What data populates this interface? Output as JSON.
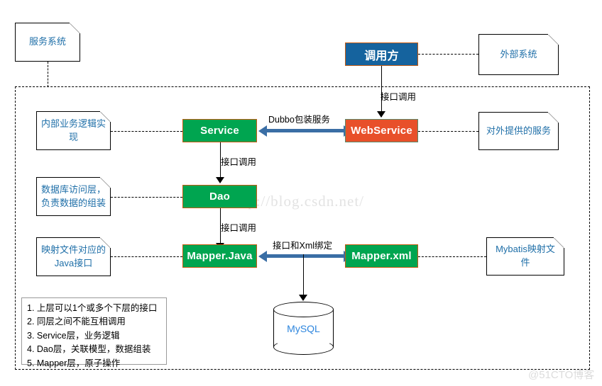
{
  "diagram": {
    "title_note": "服务系统",
    "boundary_label": "",
    "watermarks": {
      "url": "http://blog.csdn.net/",
      "site": "@51CTO博客"
    },
    "notes": {
      "service_system": "服务系统",
      "external_system": "外部系统",
      "service_desc": "内部业务逻辑实现",
      "dao_desc": "数据库访问层，负责数据的组装",
      "mapper_java_desc": "映射文件对应的Java接口",
      "webservice_desc": "对外提供的服务",
      "mapper_xml_desc": "Mybatis映射文件"
    },
    "boxes": {
      "caller": "调用方",
      "service": "Service",
      "webservice": "WebService",
      "dao": "Dao",
      "mapper_java": "Mapper.Java",
      "mapper_xml": "Mapper.xml",
      "database": "MySQL"
    },
    "edge_labels": {
      "caller_to_webservice": "接口调用",
      "service_to_webservice": "Dubbo包装服务",
      "service_to_dao": "接口调用",
      "dao_to_mapper": "接口调用",
      "mapper_binding": "接口和Xml绑定"
    },
    "legend": {
      "items": [
        "1. 上层可以1个或多个下层的接口",
        "2. 同层之间不能互相调用",
        "3. Service层，业务逻辑",
        "4. Dao层，关联模型，数据组装",
        "5. Mapper层，原子操作"
      ]
    },
    "colors": {
      "green": "#00A550",
      "orange": "#E8502A",
      "blue": "#15639E",
      "note_text": "#1F6FA8",
      "arrow_blue": "#3A6EA5",
      "border_orange": "#C55A11"
    }
  }
}
